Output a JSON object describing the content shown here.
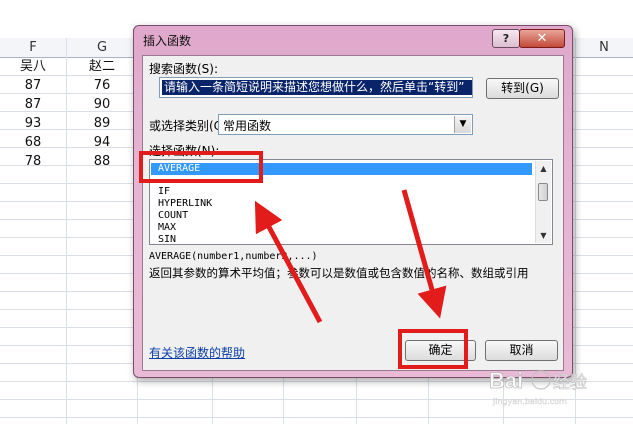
{
  "sheet": {
    "columns": [
      "F",
      "G",
      "N"
    ],
    "cells": [
      [
        "吴八",
        "赵二"
      ],
      [
        "87",
        "76"
      ],
      [
        "87",
        "90"
      ],
      [
        "93",
        "89"
      ],
      [
        "68",
        "94"
      ],
      [
        "78",
        "88"
      ]
    ]
  },
  "dialog": {
    "title": "插入函数",
    "help_btn": "?",
    "close_btn": "✕",
    "search_label": "搜索函数(S):",
    "search_value": "请输入一条简短说明来描述您想做什么，然后单击“转到”",
    "goto_btn": "转到(G)",
    "category_label": "或选择类别(C):",
    "category_value": "常用函数",
    "select_label": "选择函数(N):",
    "functions": [
      "AVERAGE",
      "IF",
      "HYPERLINK",
      "COUNT",
      "MAX",
      "SIN"
    ],
    "selected_function": "AVERAGE",
    "signature": "AVERAGE(number1,number2,...)",
    "description": "返回其参数的算术平均值；参数可以是数值或包含数值的名称、数组或引用",
    "help_link": "有关该函数的帮助",
    "ok_btn": "确定",
    "cancel_btn": "取消"
  },
  "colors": {
    "annotation": "#e21b1b",
    "selection": "#3399ff",
    "dialog_frame": "#e6b3d2"
  },
  "watermark": {
    "text": "Baidu经验",
    "url": "jingyan.baidu.com"
  }
}
